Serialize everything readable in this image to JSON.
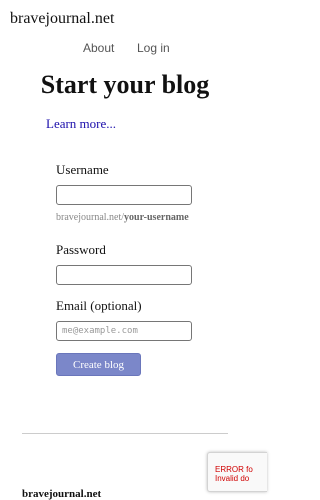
{
  "header": {
    "site_name": "bravejournal.net",
    "nav": {
      "about": "About",
      "login": "Log in"
    }
  },
  "main": {
    "title": "Start your blog",
    "learn_more": "Learn more...",
    "form": {
      "username_label": "Username",
      "username_value": "",
      "url_hint_prefix": "bravejournal.net/",
      "url_hint_placeholder": "your-username",
      "password_label": "Password",
      "password_value": "",
      "email_label": "Email (optional)",
      "email_value": "",
      "email_placeholder": "me@example.com",
      "submit_label": "Create blog",
      "submit_color": "#7b87c9"
    }
  },
  "footer": {
    "site_name": "bravejournal.net"
  },
  "recaptcha_badge": {
    "line1": "ERROR fo",
    "line2": "Invalid do",
    "text_color": "#d00000"
  },
  "colors": {
    "link": "#1a0dab",
    "nav": "#555555"
  }
}
